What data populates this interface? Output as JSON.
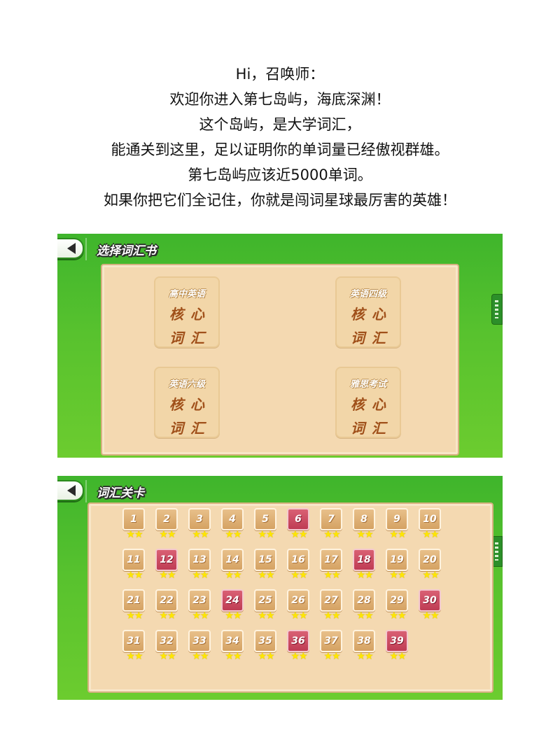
{
  "intro": {
    "lines": [
      "Hi，召唤师：",
      "欢迎你进入第七岛屿，海底深渊！",
      "这个岛屿，是大学词汇，",
      "能通关到这里，足以证明你的单词量已经傲视群雄。",
      "第七岛屿应该近5000单词。",
      "如果你把它们全记住，你就是闯词星球最厉害的英雄！"
    ]
  },
  "shot1": {
    "title": "选择词汇书",
    "books": [
      {
        "name": "高中英语",
        "core1": "核心",
        "core2": "词汇"
      },
      {
        "name": "英语四级",
        "core1": "核心",
        "core2": "词汇"
      },
      {
        "name": "英语六级",
        "core1": "核心",
        "core2": "词汇"
      },
      {
        "name": "雅思考试",
        "core1": "核心",
        "core2": "词汇"
      }
    ]
  },
  "shot2": {
    "title": "词汇关卡",
    "star_glyph": "★★",
    "star_color": "#ffe600",
    "highlight_color": "#c8435a",
    "levels": [
      {
        "label": "1",
        "red": false
      },
      {
        "label": "2",
        "red": false
      },
      {
        "label": "3",
        "red": false
      },
      {
        "label": "4",
        "red": false
      },
      {
        "label": "5",
        "red": false
      },
      {
        "label": "6",
        "red": true
      },
      {
        "label": "7",
        "red": false
      },
      {
        "label": "8",
        "red": false
      },
      {
        "label": "9",
        "red": false
      },
      {
        "label": "10",
        "red": false
      },
      {
        "label": "11",
        "red": false
      },
      {
        "label": "12",
        "red": true
      },
      {
        "label": "13",
        "red": false
      },
      {
        "label": "14",
        "red": false
      },
      {
        "label": "15",
        "red": false
      },
      {
        "label": "16",
        "red": false
      },
      {
        "label": "17",
        "red": false
      },
      {
        "label": "18",
        "red": true
      },
      {
        "label": "19",
        "red": false
      },
      {
        "label": "20",
        "red": false
      },
      {
        "label": "21",
        "red": false
      },
      {
        "label": "22",
        "red": false
      },
      {
        "label": "23",
        "red": false
      },
      {
        "label": "24",
        "red": true
      },
      {
        "label": "25",
        "red": false
      },
      {
        "label": "26",
        "red": false
      },
      {
        "label": "27",
        "red": false
      },
      {
        "label": "28",
        "red": false
      },
      {
        "label": "29",
        "red": false
      },
      {
        "label": "30",
        "red": true
      },
      {
        "label": "31",
        "red": false
      },
      {
        "label": "32",
        "red": false
      },
      {
        "label": "33",
        "red": false
      },
      {
        "label": "34",
        "red": false
      },
      {
        "label": "35",
        "red": false
      },
      {
        "label": "36",
        "red": true
      },
      {
        "label": "37",
        "red": false
      },
      {
        "label": "38",
        "red": false
      },
      {
        "label": "39",
        "red": true
      }
    ]
  }
}
